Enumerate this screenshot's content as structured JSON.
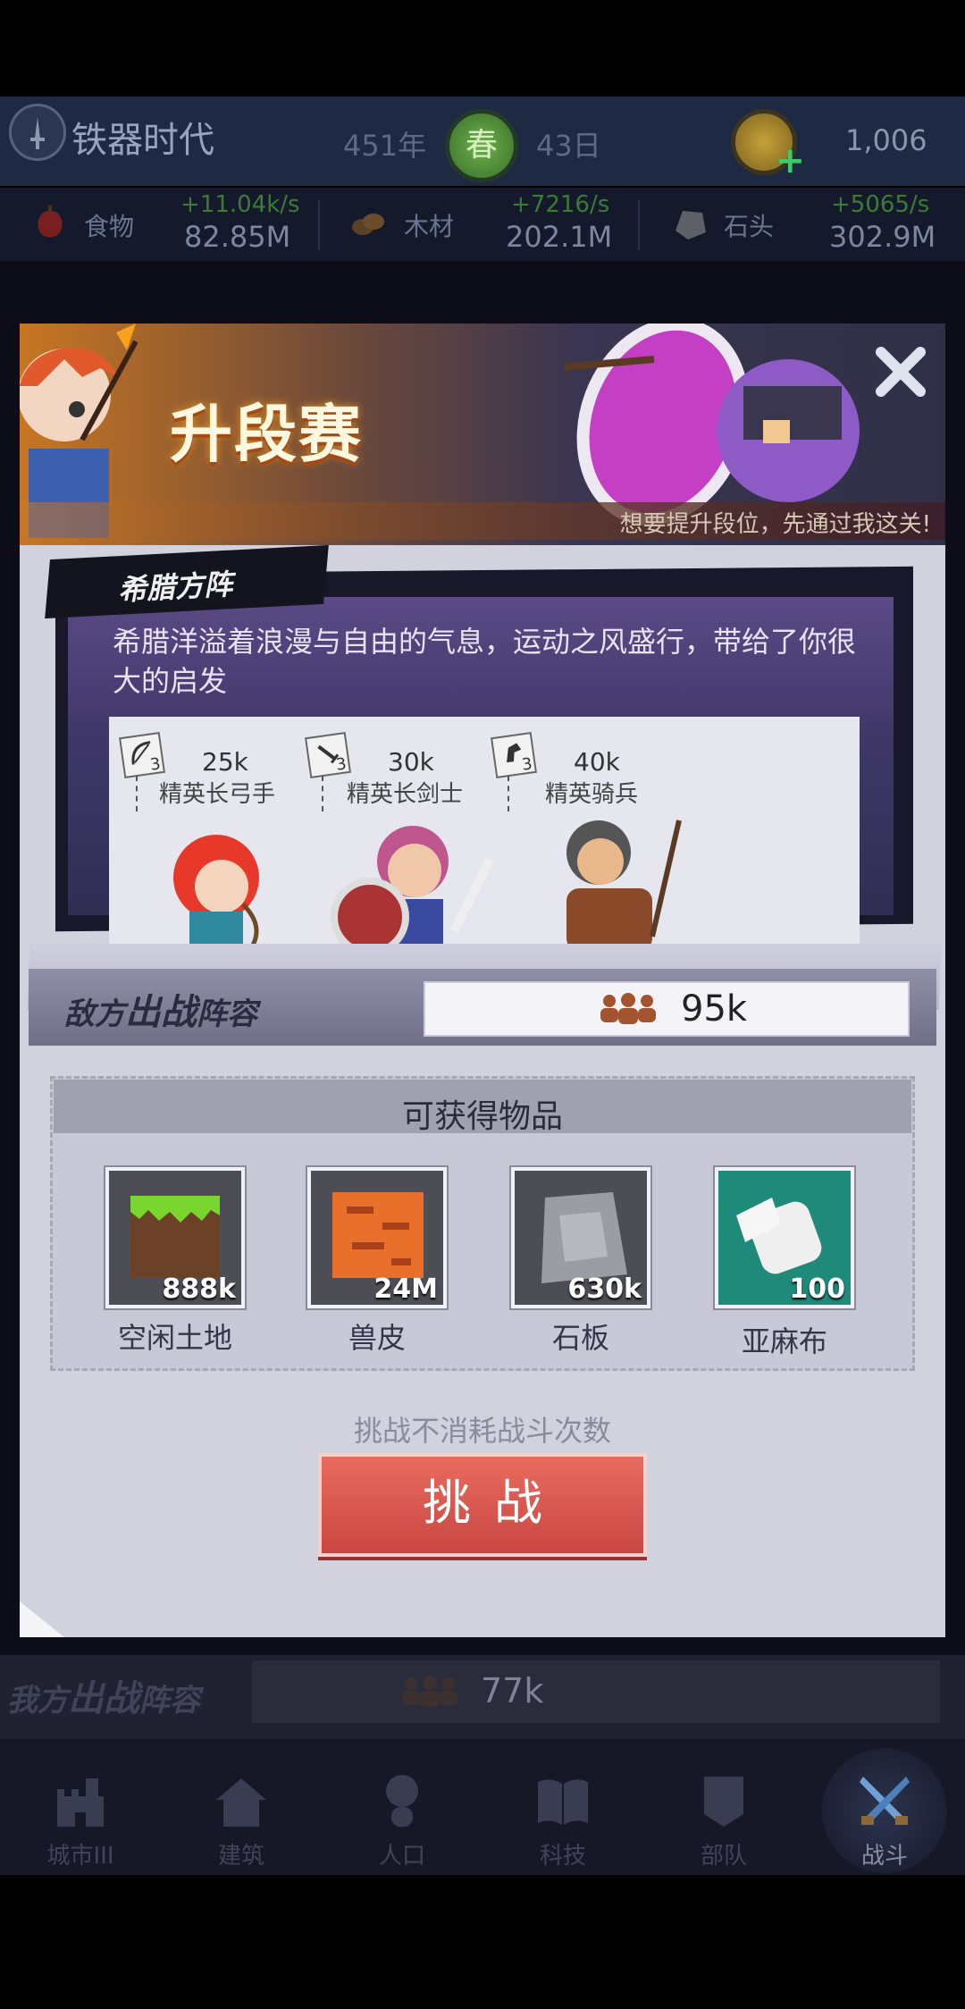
{
  "header": {
    "era_name": "铁器时代",
    "year": "451年",
    "season": "春",
    "day": "43日",
    "currency": "1,006"
  },
  "resources": [
    {
      "label": "食物",
      "rate": "+11.04k/s",
      "total": "82.85M",
      "icon": "food-icon"
    },
    {
      "label": "木材",
      "rate": "+7216/s",
      "total": "202.1M",
      "icon": "wood-icon"
    },
    {
      "label": "石头",
      "rate": "+5065/s",
      "total": "302.9M",
      "icon": "stone-icon"
    }
  ],
  "modal": {
    "title": "升段赛",
    "subtitle": "想要提升段位，先通过我这关!",
    "formation": {
      "name": "希腊方阵",
      "description": "希腊洋溢着浪漫与自由的气息，运动之风盛行，带给了你很大的启发",
      "units": [
        {
          "name": "精英长弓手",
          "power": "25k",
          "level": "3",
          "icon": "bow-icon"
        },
        {
          "name": "精英长剑士",
          "power": "30k",
          "level": "3",
          "icon": "sword-icon"
        },
        {
          "name": "精英骑兵",
          "power": "40k",
          "level": "3",
          "icon": "horse-icon"
        }
      ]
    },
    "enemy_lineup": {
      "label_prefix": "敌方",
      "label_mid": "出战",
      "label_suffix": "阵容",
      "power": "95k"
    },
    "rewards_title": "可获得物品",
    "rewards": [
      {
        "name": "空闲土地",
        "qty": "888k",
        "icon": "land-icon"
      },
      {
        "name": "兽皮",
        "qty": "24M",
        "icon": "hide-icon"
      },
      {
        "name": "石板",
        "qty": "630k",
        "icon": "stone-slab-icon"
      },
      {
        "name": "亚麻布",
        "qty": "100",
        "icon": "linen-icon"
      }
    ],
    "free_note": "挑战不消耗战斗次数",
    "challenge_label": "挑战"
  },
  "my_lineup": {
    "label_prefix": "我方",
    "label_mid": "出战",
    "label_suffix": "阵容",
    "power": "77k"
  },
  "nav": [
    {
      "label": "城市III",
      "icon": "castle-icon"
    },
    {
      "label": "建筑",
      "icon": "house-icon"
    },
    {
      "label": "人口",
      "icon": "person-icon"
    },
    {
      "label": "科技",
      "icon": "book-icon"
    },
    {
      "label": "部队",
      "icon": "banner-icon"
    },
    {
      "label": "战斗",
      "icon": "crossed-swords-icon",
      "active": true
    }
  ],
  "colors": {
    "challenge_button": "#d9574f",
    "season_badge": "#5a9a3e",
    "rate_text": "#3b7b35"
  }
}
